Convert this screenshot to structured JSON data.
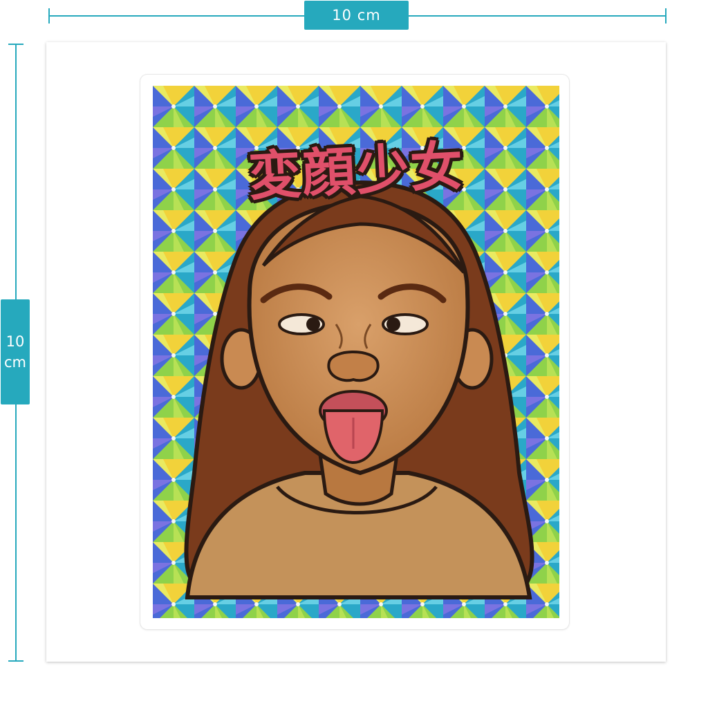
{
  "dimensions": {
    "width_label": "10 cm",
    "height_number": "10",
    "height_unit": "cm"
  },
  "sticker": {
    "title": "変顔少女",
    "title_color": "#e0506a",
    "title_outline_color": "#2a1a12"
  },
  "colors": {
    "accent": "#26a9bd",
    "hair": "#7a3b1c",
    "skin": "#c98a52",
    "shirt": "#c4925a",
    "tongue": "#e0646a"
  }
}
